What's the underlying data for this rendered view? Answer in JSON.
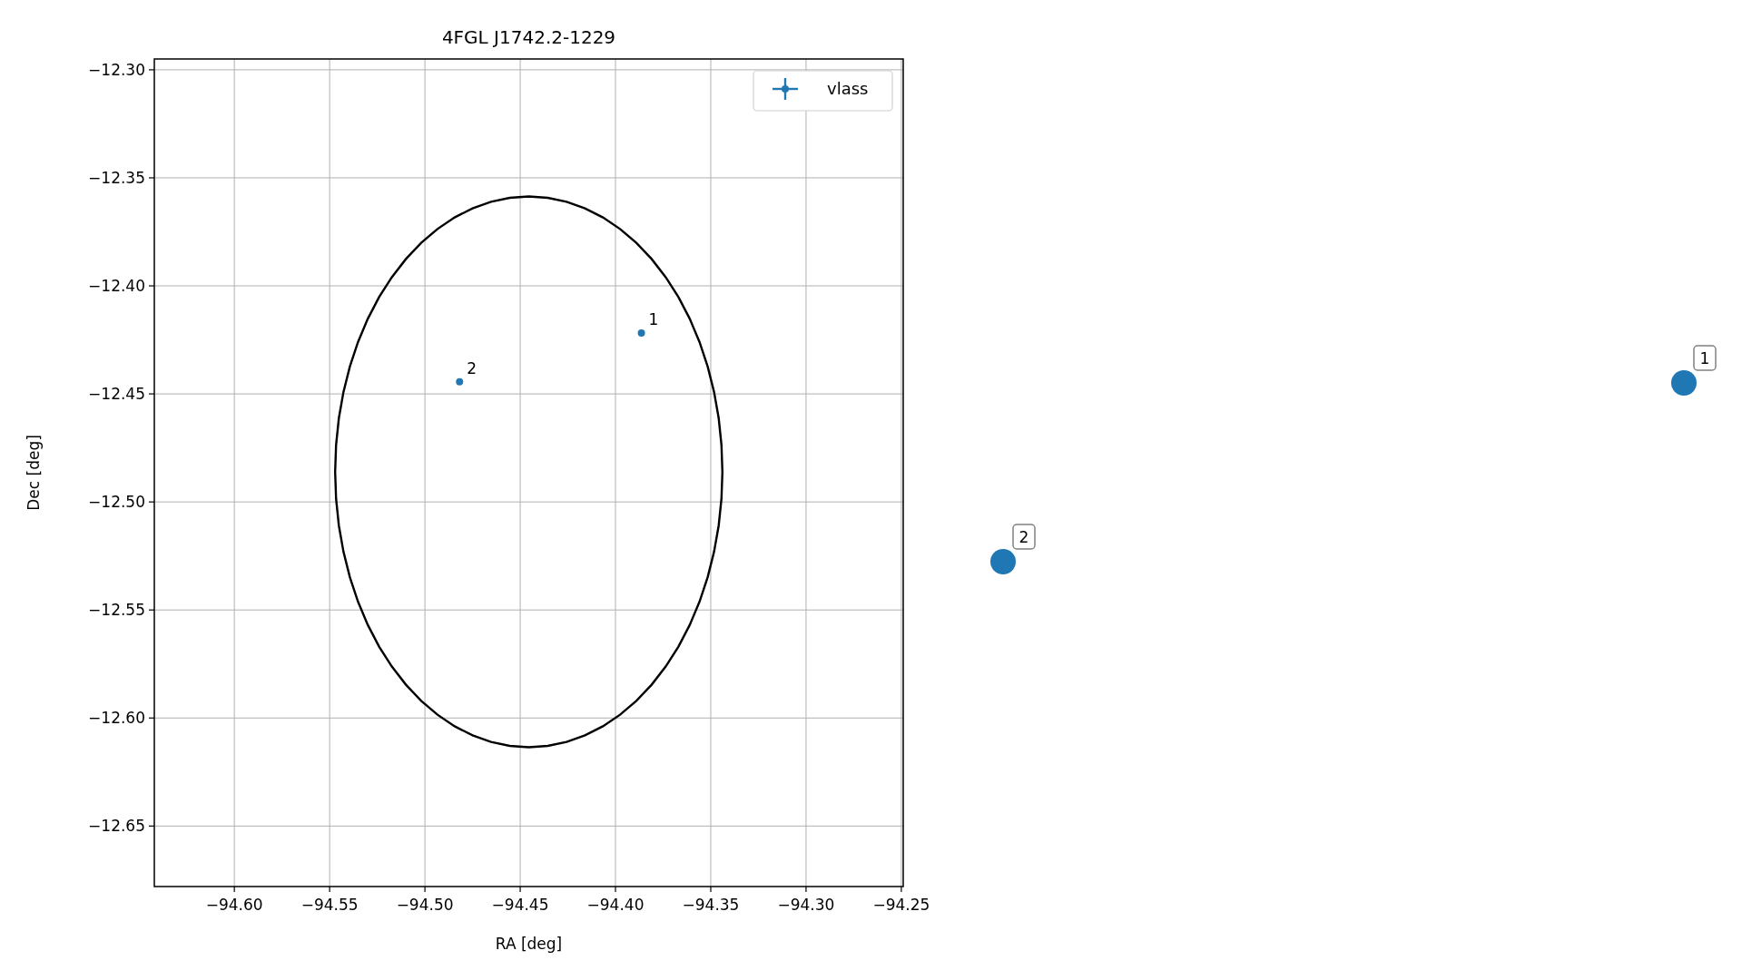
{
  "chart_data": {
    "type": "scatter",
    "title": "4FGL J1742.2-1229",
    "xlabel": "RA [deg]",
    "ylabel": "Dec [deg]",
    "grid": true,
    "xlim": [
      -94.642,
      -94.249
    ],
    "ylim": [
      -12.678,
      -12.295
    ],
    "xticks": [
      {
        "value": -94.6,
        "label": "−94.60"
      },
      {
        "value": -94.55,
        "label": "−94.55"
      },
      {
        "value": -94.5,
        "label": "−94.50"
      },
      {
        "value": -94.45,
        "label": "−94.45"
      },
      {
        "value": -94.4,
        "label": "−94.40"
      },
      {
        "value": -94.35,
        "label": "−94.35"
      },
      {
        "value": -94.3,
        "label": "−94.30"
      },
      {
        "value": -94.25,
        "label": "−94.25"
      }
    ],
    "yticks": [
      {
        "value": -12.3,
        "label": "−12.30"
      },
      {
        "value": -12.35,
        "label": "−12.35"
      },
      {
        "value": -12.4,
        "label": "−12.40"
      },
      {
        "value": -12.45,
        "label": "−12.45"
      },
      {
        "value": -12.5,
        "label": "−12.50"
      },
      {
        "value": -12.55,
        "label": "−12.55"
      },
      {
        "value": -12.6,
        "label": "−12.60"
      },
      {
        "value": -12.65,
        "label": "−12.65"
      }
    ],
    "series": [
      {
        "name": "vlass",
        "color": "#1f77b4",
        "x": [
          -94.3864,
          -94.4818
        ],
        "values": [
          -12.4218,
          -12.4444
        ]
      }
    ],
    "annotations": [
      {
        "text": "1",
        "x": -94.3864,
        "y": -12.4218
      },
      {
        "text": "2",
        "x": -94.4818,
        "y": -12.4444
      },
      "1",
      "2"
    ]
  }
}
